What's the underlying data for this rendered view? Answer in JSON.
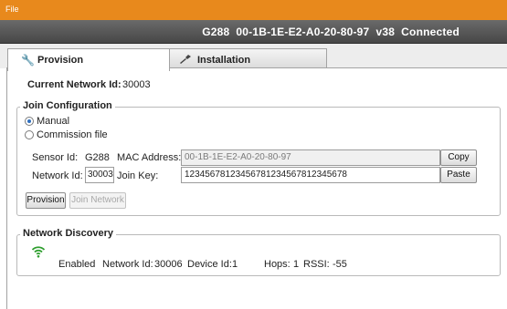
{
  "menubar": {
    "file_label": "File"
  },
  "titlebar": {
    "title": "G288  00-1B-1E-E2-A0-20-80-97  v38  Connected"
  },
  "tabs": [
    {
      "label": "Provision",
      "icon": "wrench-icon",
      "active": true
    },
    {
      "label": "Installation",
      "icon": "screwdriver-icon",
      "active": false
    }
  ],
  "provision": {
    "current_network_label": "Current Network Id:",
    "current_network_value": "30003",
    "join_config": {
      "title": "Join Configuration",
      "manual_label": "Manual",
      "commission_label": "Commission file",
      "selected": "Manual",
      "sensor_id_label": "Sensor Id:",
      "sensor_id_value": "G288",
      "mac_label": "MAC Address:",
      "mac_value": "00-1B-1E-E2-A0-20-80-97",
      "copy_label": "Copy",
      "network_id_label": "Network Id:",
      "network_id_value": "30003",
      "join_key_label": "Join Key:",
      "join_key_value": "12345678123456781234567812345678",
      "paste_label": "Paste"
    },
    "provision_button_label": "Provision",
    "join_network_button_label": "Join Network",
    "network_discovery": {
      "title": "Network Discovery",
      "status": "Enabled",
      "network_id_label": "Network Id:",
      "network_id_value": "30006",
      "device_id_label": "Device Id:",
      "device_id_value": "1",
      "hops_label": "Hops:",
      "hops_value": "1",
      "rssi_label": "RSSI:",
      "rssi_value": "-55",
      "signal_color": "#2e9e2e"
    }
  },
  "colors": {
    "menubar": "#e8891c",
    "titlebar": "#555555"
  }
}
